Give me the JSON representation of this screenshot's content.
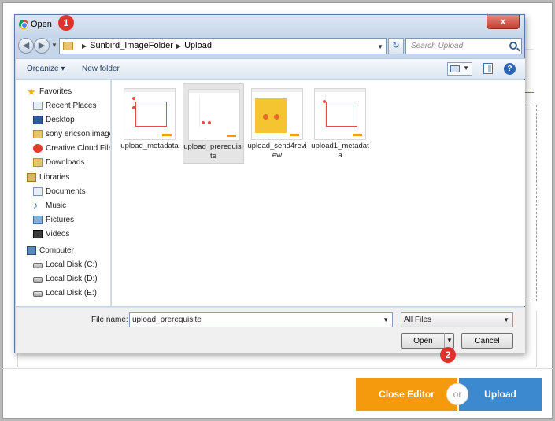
{
  "page": {
    "close_editor_label": "Close Editor",
    "or_label": "or",
    "upload_label": "Upload"
  },
  "dialog": {
    "title": "Open",
    "close_glyph": "x",
    "breadcrumb": [
      "Sunbird_ImageFolder",
      "Upload"
    ],
    "search_placeholder": "Search Upload",
    "toolbar": {
      "organize_label": "Organize ▾",
      "new_folder_label": "New folder"
    },
    "nav": {
      "favorites_label": "Favorites",
      "favorites": [
        "Recent Places",
        "Desktop",
        "sony ericson images",
        "Creative Cloud Files",
        "Downloads"
      ],
      "libraries_label": "Libraries",
      "libraries": [
        "Documents",
        "Music",
        "Pictures",
        "Videos"
      ],
      "computer_label": "Computer",
      "drives": [
        "Local Disk (C:)",
        "Local Disk (D:)",
        "Local Disk (E:)"
      ]
    },
    "files": [
      {
        "name": "upload_metadata",
        "selected": false
      },
      {
        "name": "upload_prerequisite",
        "selected": true
      },
      {
        "name": "upload_send4review",
        "selected": false
      },
      {
        "name": "upload1_metadata",
        "selected": false
      }
    ],
    "file_name_label": "File name:",
    "file_name_value": "upload_prerequisite",
    "file_type_value": "All Files",
    "open_label": "Open",
    "cancel_label": "Cancel"
  },
  "badges": {
    "step1": "1",
    "step2": "2",
    "color": "#e0322c"
  },
  "colors": {
    "close_editor": "#f59a0c",
    "upload": "#3d89cf"
  }
}
